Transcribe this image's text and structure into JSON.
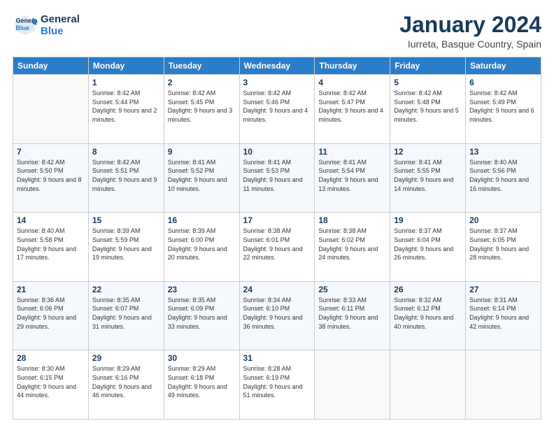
{
  "header": {
    "logo_line1": "General",
    "logo_line2": "Blue",
    "month": "January 2024",
    "location": "Iurreta, Basque Country, Spain"
  },
  "columns": [
    "Sunday",
    "Monday",
    "Tuesday",
    "Wednesday",
    "Thursday",
    "Friday",
    "Saturday"
  ],
  "weeks": [
    [
      {
        "day": "",
        "sunrise": "",
        "sunset": "",
        "daylight": ""
      },
      {
        "day": "1",
        "sunrise": "Sunrise: 8:42 AM",
        "sunset": "Sunset: 5:44 PM",
        "daylight": "Daylight: 9 hours and 2 minutes."
      },
      {
        "day": "2",
        "sunrise": "Sunrise: 8:42 AM",
        "sunset": "Sunset: 5:45 PM",
        "daylight": "Daylight: 9 hours and 3 minutes."
      },
      {
        "day": "3",
        "sunrise": "Sunrise: 8:42 AM",
        "sunset": "Sunset: 5:46 PM",
        "daylight": "Daylight: 9 hours and 4 minutes."
      },
      {
        "day": "4",
        "sunrise": "Sunrise: 8:42 AM",
        "sunset": "Sunset: 5:47 PM",
        "daylight": "Daylight: 9 hours and 4 minutes."
      },
      {
        "day": "5",
        "sunrise": "Sunrise: 8:42 AM",
        "sunset": "Sunset: 5:48 PM",
        "daylight": "Daylight: 9 hours and 5 minutes."
      },
      {
        "day": "6",
        "sunrise": "Sunrise: 8:42 AM",
        "sunset": "Sunset: 5:49 PM",
        "daylight": "Daylight: 9 hours and 6 minutes."
      }
    ],
    [
      {
        "day": "7",
        "sunrise": "Sunrise: 8:42 AM",
        "sunset": "Sunset: 5:50 PM",
        "daylight": "Daylight: 9 hours and 8 minutes."
      },
      {
        "day": "8",
        "sunrise": "Sunrise: 8:42 AM",
        "sunset": "Sunset: 5:51 PM",
        "daylight": "Daylight: 9 hours and 9 minutes."
      },
      {
        "day": "9",
        "sunrise": "Sunrise: 8:41 AM",
        "sunset": "Sunset: 5:52 PM",
        "daylight": "Daylight: 9 hours and 10 minutes."
      },
      {
        "day": "10",
        "sunrise": "Sunrise: 8:41 AM",
        "sunset": "Sunset: 5:53 PM",
        "daylight": "Daylight: 9 hours and 11 minutes."
      },
      {
        "day": "11",
        "sunrise": "Sunrise: 8:41 AM",
        "sunset": "Sunset: 5:54 PM",
        "daylight": "Daylight: 9 hours and 13 minutes."
      },
      {
        "day": "12",
        "sunrise": "Sunrise: 8:41 AM",
        "sunset": "Sunset: 5:55 PM",
        "daylight": "Daylight: 9 hours and 14 minutes."
      },
      {
        "day": "13",
        "sunrise": "Sunrise: 8:40 AM",
        "sunset": "Sunset: 5:56 PM",
        "daylight": "Daylight: 9 hours and 16 minutes."
      }
    ],
    [
      {
        "day": "14",
        "sunrise": "Sunrise: 8:40 AM",
        "sunset": "Sunset: 5:58 PM",
        "daylight": "Daylight: 9 hours and 17 minutes."
      },
      {
        "day": "15",
        "sunrise": "Sunrise: 8:39 AM",
        "sunset": "Sunset: 5:59 PM",
        "daylight": "Daylight: 9 hours and 19 minutes."
      },
      {
        "day": "16",
        "sunrise": "Sunrise: 8:39 AM",
        "sunset": "Sunset: 6:00 PM",
        "daylight": "Daylight: 9 hours and 20 minutes."
      },
      {
        "day": "17",
        "sunrise": "Sunrise: 8:38 AM",
        "sunset": "Sunset: 6:01 PM",
        "daylight": "Daylight: 9 hours and 22 minutes."
      },
      {
        "day": "18",
        "sunrise": "Sunrise: 8:38 AM",
        "sunset": "Sunset: 6:02 PM",
        "daylight": "Daylight: 9 hours and 24 minutes."
      },
      {
        "day": "19",
        "sunrise": "Sunrise: 8:37 AM",
        "sunset": "Sunset: 6:04 PM",
        "daylight": "Daylight: 9 hours and 26 minutes."
      },
      {
        "day": "20",
        "sunrise": "Sunrise: 8:37 AM",
        "sunset": "Sunset: 6:05 PM",
        "daylight": "Daylight: 9 hours and 28 minutes."
      }
    ],
    [
      {
        "day": "21",
        "sunrise": "Sunrise: 8:36 AM",
        "sunset": "Sunset: 6:06 PM",
        "daylight": "Daylight: 9 hours and 29 minutes."
      },
      {
        "day": "22",
        "sunrise": "Sunrise: 8:35 AM",
        "sunset": "Sunset: 6:07 PM",
        "daylight": "Daylight: 9 hours and 31 minutes."
      },
      {
        "day": "23",
        "sunrise": "Sunrise: 8:35 AM",
        "sunset": "Sunset: 6:09 PM",
        "daylight": "Daylight: 9 hours and 33 minutes."
      },
      {
        "day": "24",
        "sunrise": "Sunrise: 8:34 AM",
        "sunset": "Sunset: 6:10 PM",
        "daylight": "Daylight: 9 hours and 36 minutes."
      },
      {
        "day": "25",
        "sunrise": "Sunrise: 8:33 AM",
        "sunset": "Sunset: 6:11 PM",
        "daylight": "Daylight: 9 hours and 38 minutes."
      },
      {
        "day": "26",
        "sunrise": "Sunrise: 8:32 AM",
        "sunset": "Sunset: 6:12 PM",
        "daylight": "Daylight: 9 hours and 40 minutes."
      },
      {
        "day": "27",
        "sunrise": "Sunrise: 8:31 AM",
        "sunset": "Sunset: 6:14 PM",
        "daylight": "Daylight: 9 hours and 42 minutes."
      }
    ],
    [
      {
        "day": "28",
        "sunrise": "Sunrise: 8:30 AM",
        "sunset": "Sunset: 6:15 PM",
        "daylight": "Daylight: 9 hours and 44 minutes."
      },
      {
        "day": "29",
        "sunrise": "Sunrise: 8:29 AM",
        "sunset": "Sunset: 6:16 PM",
        "daylight": "Daylight: 9 hours and 46 minutes."
      },
      {
        "day": "30",
        "sunrise": "Sunrise: 8:29 AM",
        "sunset": "Sunset: 6:18 PM",
        "daylight": "Daylight: 9 hours and 49 minutes."
      },
      {
        "day": "31",
        "sunrise": "Sunrise: 8:28 AM",
        "sunset": "Sunset: 6:19 PM",
        "daylight": "Daylight: 9 hours and 51 minutes."
      },
      {
        "day": "",
        "sunrise": "",
        "sunset": "",
        "daylight": ""
      },
      {
        "day": "",
        "sunrise": "",
        "sunset": "",
        "daylight": ""
      },
      {
        "day": "",
        "sunrise": "",
        "sunset": "",
        "daylight": ""
      }
    ]
  ]
}
